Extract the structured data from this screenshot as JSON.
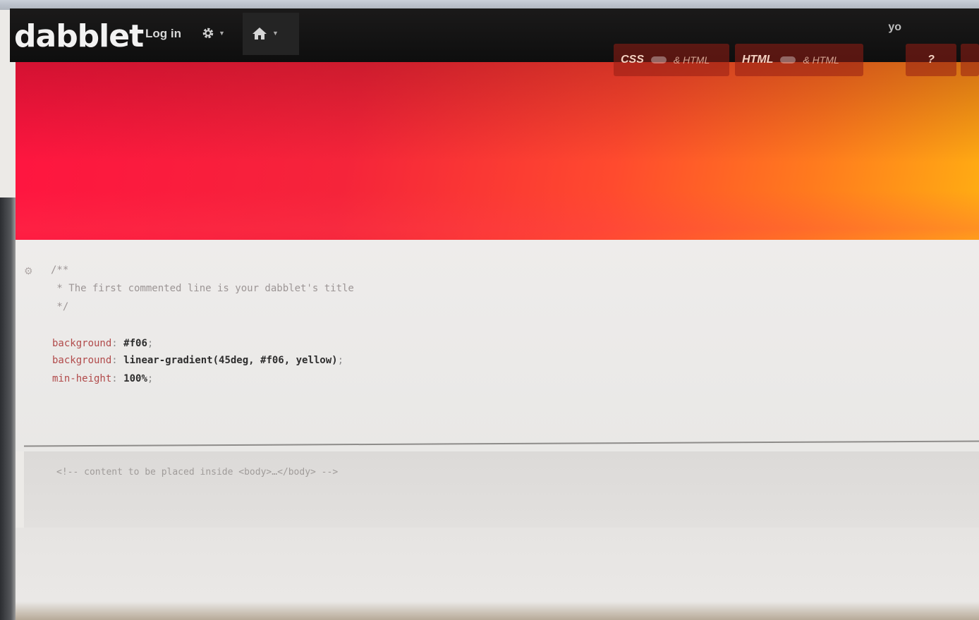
{
  "header": {
    "logo_text": "dabblet",
    "login_label": "Log in",
    "settings_icon": "gear-icon",
    "home_icon": "home-icon",
    "user_label": "yo"
  },
  "view_tabs": [
    {
      "label": "CSS",
      "sub": "& HTML"
    },
    {
      "label": "HTML",
      "sub": "& HTML"
    },
    {
      "label": "?"
    }
  ],
  "css_editor": {
    "comment_lines": [
      "/**",
      " * The first commented line is your dabblet's title",
      " */"
    ],
    "rules": [
      {
        "property": "background",
        "value": "#f06",
        "end": ";"
      },
      {
        "property": "background",
        "value": "linear-gradient(45deg, #f06, yellow)",
        "end": ";"
      },
      {
        "property": "min-height",
        "value": "100%",
        "end": ";"
      }
    ]
  },
  "html_editor": {
    "content": "<!-- content to be placed inside <body>…</body> -->"
  },
  "colors": {
    "preview_start": "#ff0066",
    "preview_end": "#ffff00",
    "topbar": "#111111"
  }
}
